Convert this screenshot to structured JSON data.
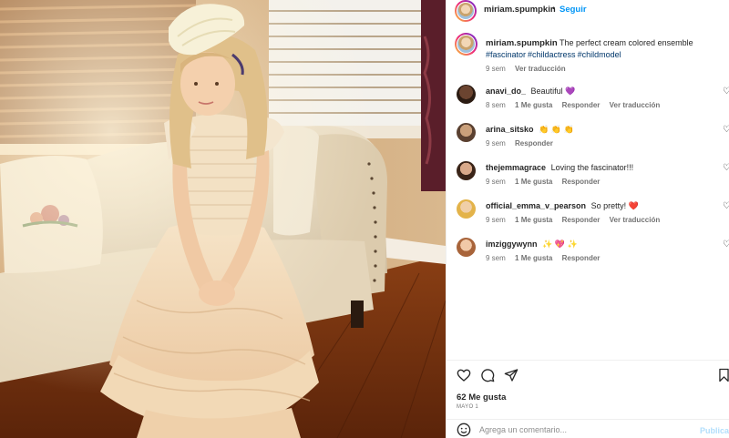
{
  "post": {
    "username": "miriam.spumpkin",
    "separator": "•",
    "follow_label": "Seguir",
    "caption_text": "The perfect cream colored ensemble",
    "hashtags": [
      "#fascinator",
      "#childactress",
      "#childmodel"
    ],
    "caption_age": "9 sem",
    "caption_translate": "Ver traducción"
  },
  "comments": [
    {
      "user": "anavi_do_",
      "text": "Beautiful",
      "emoji": "💜",
      "age": "8 sem",
      "likes": "1 Me gusta",
      "reply": "Responder",
      "translate": "Ver traducción"
    },
    {
      "user": "arina_sitsko",
      "text": "",
      "emoji": "👏 👏 👏",
      "age": "9 sem",
      "likes": "",
      "reply": "Responder",
      "translate": ""
    },
    {
      "user": "thejemmagrace",
      "text": "Loving the fascinator!!!",
      "emoji": "",
      "age": "9 sem",
      "likes": "1 Me gusta",
      "reply": "Responder",
      "translate": ""
    },
    {
      "user": "official_emma_v_pearson",
      "text": "So pretty!",
      "emoji": "❤️",
      "age": "9 sem",
      "likes": "1 Me gusta",
      "reply": "Responder",
      "translate": "Ver traducción"
    },
    {
      "user": "imziggywynn",
      "text": "",
      "emoji": "✨ 💖 ✨",
      "age": "9 sem",
      "likes": "1 Me gusta",
      "reply": "Responder",
      "translate": ""
    }
  ],
  "footer": {
    "likes": "62 Me gusta",
    "date": "MAYO 1",
    "comment_placeholder": "Agrega un comentario...",
    "publish_label": "Publicar"
  },
  "icons": {
    "like": "heart-outline-icon",
    "comment": "comment-bubble-icon",
    "share": "paper-plane-icon",
    "save": "bookmark-icon",
    "emoji": "smiley-icon",
    "comment_like": "small-heart-icon"
  },
  "colors": {
    "accent": "#0095f6",
    "hashtag": "#00376b",
    "muted": "#737373"
  }
}
